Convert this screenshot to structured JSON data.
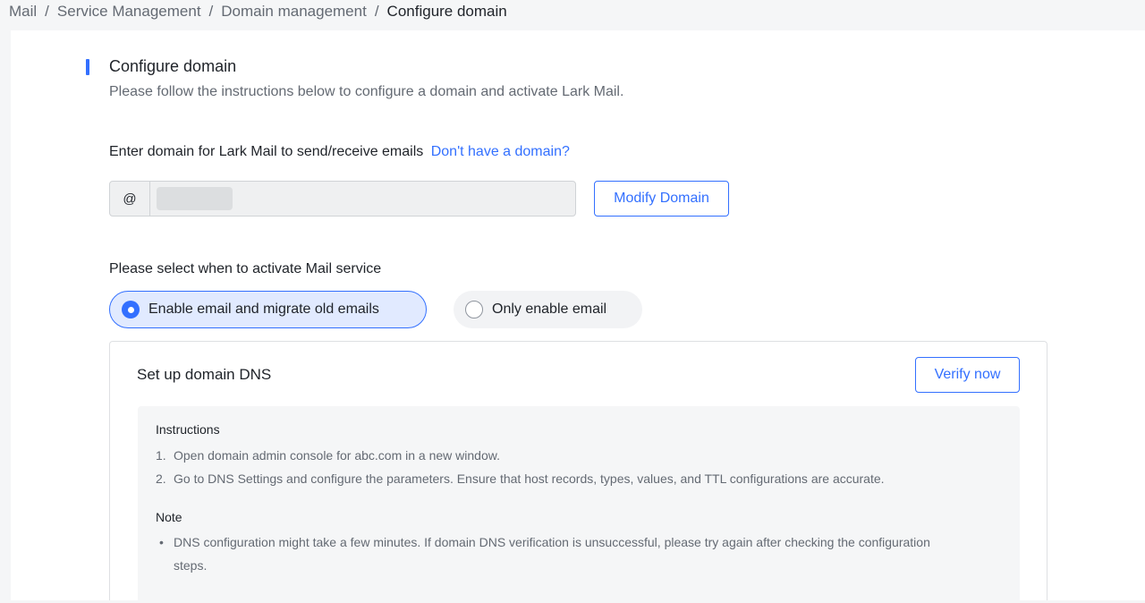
{
  "breadcrumb": {
    "items": [
      "Mail",
      "Service Management",
      "Domain management"
    ],
    "current": "Configure domain",
    "separator": "/"
  },
  "section": {
    "title": "Configure domain",
    "description": "Please follow the instructions below to configure a domain and activate Lark Mail."
  },
  "domain": {
    "label": "Enter domain for Lark Mail to send/receive emails",
    "link": "Don't have a domain?",
    "prefix": "@",
    "modify_button": "Modify Domain"
  },
  "activation": {
    "label": "Please select when to activate Mail service",
    "options": [
      {
        "label": "Enable email and migrate old emails",
        "selected": true
      },
      {
        "label": "Only enable email",
        "selected": false
      }
    ]
  },
  "dns": {
    "title": "Set up domain DNS",
    "verify_button": "Verify now",
    "instructions_heading": "Instructions",
    "steps": [
      {
        "num": "1.",
        "text": "Open domain admin console for abc.com in a new window."
      },
      {
        "num": "2.",
        "text": "Go to DNS Settings and configure the parameters. Ensure that host records, types, values, and TTL configurations are accurate."
      }
    ],
    "note_heading": "Note",
    "notes": [
      {
        "bullet": "•",
        "text": "DNS configuration might take a few minutes. If domain DNS verification is unsuccessful, please try again after checking the configuration steps."
      }
    ]
  },
  "colors": {
    "accent": "#3370ff",
    "selected_bg": "#e1eaff",
    "muted_text": "#646a73"
  }
}
